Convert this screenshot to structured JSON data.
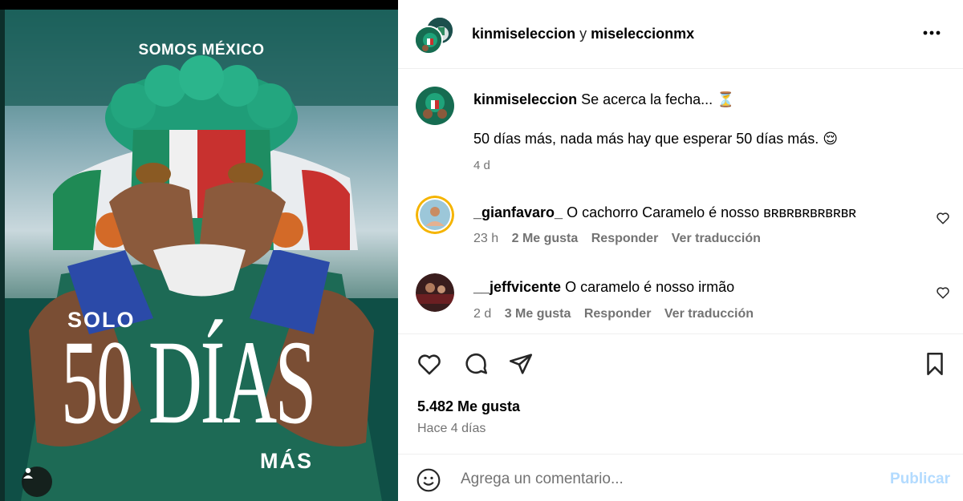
{
  "post": {
    "brand_text": "SOMOS MÉXICO",
    "headline_top": "SOLO",
    "headline_big": "50 DÍAS",
    "headline_bottom": "MÁS"
  },
  "header": {
    "author": "kinmiseleccion",
    "joiner": "y",
    "coauthor": "miseleccionmx",
    "more_icon": "more-horizontal-icon"
  },
  "caption": {
    "username": "kinmiseleccion",
    "line1": "Se acerca la fecha... ⏳",
    "line2": "50 días más, nada más hay que esperar 50 días más. 😌",
    "time": "4 d"
  },
  "comments": [
    {
      "username": "_gianfavaro_",
      "text": "O cachorro Caramelo é nosso ʙʀʙʀʙʀʙʀʙʀʙʀ",
      "time": "23 h",
      "likes": "2 Me gusta",
      "reply": "Responder",
      "translate": "Ver traducción"
    },
    {
      "username": "__jeffvicente",
      "text": "O caramelo é nosso irmão",
      "time": "2 d",
      "likes": "3 Me gusta",
      "reply": "Responder",
      "translate": "Ver traducción"
    }
  ],
  "actions": {
    "likes_count": "5.482 Me gusta",
    "posted_ago": "Hace 4 días",
    "icons": [
      "heart-icon",
      "comment-icon",
      "share-icon",
      "bookmark-icon"
    ]
  },
  "composer": {
    "placeholder": "Agrega un comentario...",
    "publish_label": "Publicar"
  },
  "colors": {
    "publish_disabled": "#b3dbff",
    "secondary_text": "#737373",
    "poster_green": "#1c5c50"
  }
}
